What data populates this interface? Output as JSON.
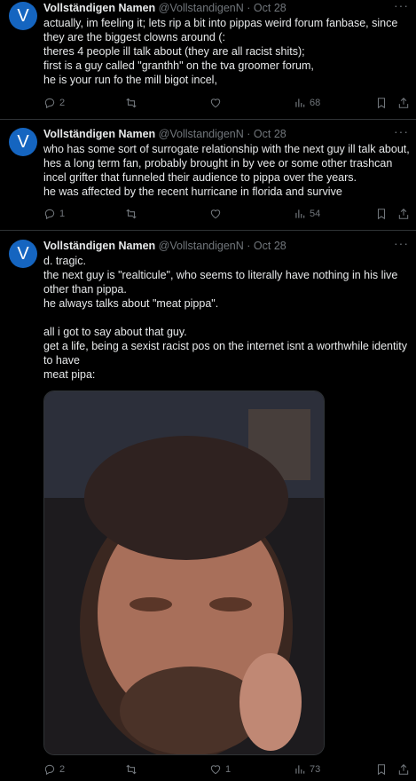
{
  "tweets": [
    {
      "avatar_letter": "V",
      "name": "Vollständigen Namen",
      "handle": "@VollstandigenN",
      "sep": "·",
      "date": "Oct 28",
      "more": "···",
      "lines": [
        "actually, im feeling it; lets rip a bit into pippas weird forum fanbase, since",
        "they are the biggest clowns around (:",
        "theres 4 people ill talk about (they are all racist shits);",
        "first is a guy called \"granthh\" on the tva groomer forum,",
        "he is your run fo the mill bigot incel,"
      ],
      "replies": "2",
      "retweets": "",
      "likes": "",
      "views": "68"
    },
    {
      "avatar_letter": "V",
      "name": "Vollständigen Namen",
      "handle": "@VollstandigenN",
      "sep": "·",
      "date": "Oct 28",
      "more": "···",
      "lines": [
        "who has some sort of surrogate relationship with the next guy ill talk about,",
        "hes a long term fan, probably brought in by vee or some other trashcan",
        "incel grifter that funneled their audience to pippa over the years.",
        "he was affected by the recent hurricane in florida and survive"
      ],
      "replies": "1",
      "retweets": "",
      "likes": "",
      "views": "54"
    },
    {
      "avatar_letter": "V",
      "name": "Vollständigen Namen",
      "handle": "@VollstandigenN",
      "sep": "·",
      "date": "Oct 28",
      "more": "···",
      "lines": [
        "d. tragic.",
        "the next guy is \"realticule\", who seems to literally have nothing in his live",
        "other than pippa.",
        "he always talks about \"meat pippa\".",
        "",
        "all i got to say about that guy.",
        "get a life, being a sexist racist pos on the internet isnt a worthwhile identity",
        "to have",
        "meat pipa:"
      ],
      "replies": "2",
      "retweets": "",
      "likes": "1",
      "views": "73"
    }
  ],
  "icons": {
    "reply": "reply-icon",
    "retweet": "retweet-icon",
    "like": "heart-icon",
    "views": "views-icon",
    "bookmark": "bookmark-icon",
    "share": "share-icon"
  },
  "colors": {
    "background": "#000000",
    "text": "#e7e9ea",
    "muted": "#71767b",
    "avatar": "#1565c0",
    "divider": "#2f3336"
  }
}
